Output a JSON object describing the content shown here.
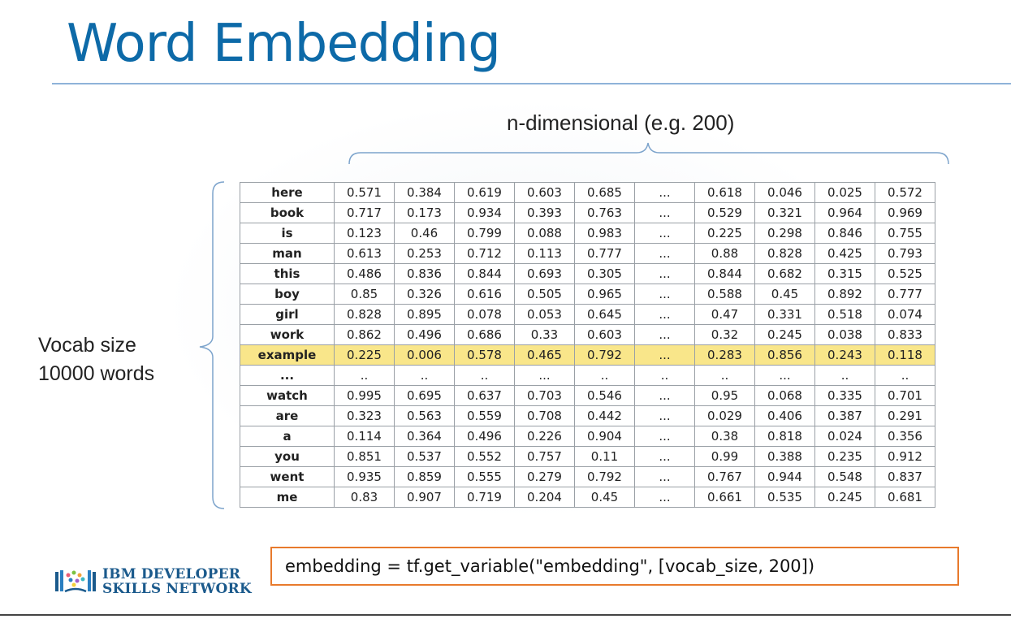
{
  "slide": {
    "title": "Word Embedding",
    "dimension_label": "n-dimensional (e.g. 200)",
    "vocab_label_line1": "Vocab size",
    "vocab_label_line2": "10000 words",
    "code": "embedding = tf.get_variable(\"embedding\", [vocab_size, 200])",
    "logo_line1": "IBM DEVELOPER",
    "logo_line2": "SKILLS NETWORK"
  },
  "colors": {
    "title": "#0d6aa8",
    "highlight_row": "#f9e68a",
    "code_border": "#e87a2c",
    "logo_text": "#1b5a8c"
  },
  "table": {
    "highlight_word": "example",
    "rows": [
      {
        "word": "here",
        "values": [
          "0.571",
          "0.384",
          "0.619",
          "0.603",
          "0.685",
          "...",
          "0.618",
          "0.046",
          "0.025",
          "0.572"
        ]
      },
      {
        "word": "book",
        "values": [
          "0.717",
          "0.173",
          "0.934",
          "0.393",
          "0.763",
          "...",
          "0.529",
          "0.321",
          "0.964",
          "0.969"
        ]
      },
      {
        "word": "is",
        "values": [
          "0.123",
          "0.46",
          "0.799",
          "0.088",
          "0.983",
          "...",
          "0.225",
          "0.298",
          "0.846",
          "0.755"
        ]
      },
      {
        "word": "man",
        "values": [
          "0.613",
          "0.253",
          "0.712",
          "0.113",
          "0.777",
          "...",
          "0.88",
          "0.828",
          "0.425",
          "0.793"
        ]
      },
      {
        "word": "this",
        "values": [
          "0.486",
          "0.836",
          "0.844",
          "0.693",
          "0.305",
          "...",
          "0.844",
          "0.682",
          "0.315",
          "0.525"
        ]
      },
      {
        "word": "boy",
        "values": [
          "0.85",
          "0.326",
          "0.616",
          "0.505",
          "0.965",
          "...",
          "0.588",
          "0.45",
          "0.892",
          "0.777"
        ]
      },
      {
        "word": "girl",
        "values": [
          "0.828",
          "0.895",
          "0.078",
          "0.053",
          "0.645",
          "...",
          "0.47",
          "0.331",
          "0.518",
          "0.074"
        ]
      },
      {
        "word": "work",
        "values": [
          "0.862",
          "0.496",
          "0.686",
          "0.33",
          "0.603",
          "...",
          "0.32",
          "0.245",
          "0.038",
          "0.833"
        ]
      },
      {
        "word": "example",
        "values": [
          "0.225",
          "0.006",
          "0.578",
          "0.465",
          "0.792",
          "...",
          "0.283",
          "0.856",
          "0.243",
          "0.118"
        ]
      },
      {
        "word": "...",
        "values": [
          "..",
          "..",
          "..",
          "...",
          "..",
          "..",
          "..",
          "...",
          "..",
          ".."
        ]
      },
      {
        "word": "watch",
        "values": [
          "0.995",
          "0.695",
          "0.637",
          "0.703",
          "0.546",
          "...",
          "0.95",
          "0.068",
          "0.335",
          "0.701"
        ]
      },
      {
        "word": "are",
        "values": [
          "0.323",
          "0.563",
          "0.559",
          "0.708",
          "0.442",
          "...",
          "0.029",
          "0.406",
          "0.387",
          "0.291"
        ]
      },
      {
        "word": "a",
        "values": [
          "0.114",
          "0.364",
          "0.496",
          "0.226",
          "0.904",
          "...",
          "0.38",
          "0.818",
          "0.024",
          "0.356"
        ]
      },
      {
        "word": "you",
        "values": [
          "0.851",
          "0.537",
          "0.552",
          "0.757",
          "0.11",
          "...",
          "0.99",
          "0.388",
          "0.235",
          "0.912"
        ]
      },
      {
        "word": "went",
        "values": [
          "0.935",
          "0.859",
          "0.555",
          "0.279",
          "0.792",
          "...",
          "0.767",
          "0.944",
          "0.548",
          "0.837"
        ]
      },
      {
        "word": "me",
        "values": [
          "0.83",
          "0.907",
          "0.719",
          "0.204",
          "0.45",
          "...",
          "0.661",
          "0.535",
          "0.245",
          "0.681"
        ]
      }
    ]
  }
}
